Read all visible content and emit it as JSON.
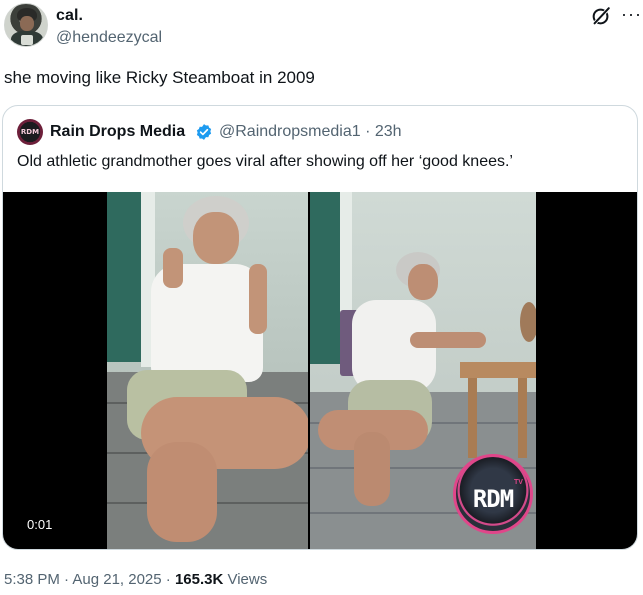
{
  "author": {
    "display_name": "cal.",
    "handle": "@hendeezycal"
  },
  "tweet": {
    "text": "she moving like Ricky Steamboat in 2009"
  },
  "quoted": {
    "display_name": "Rain Drops Media",
    "handle_time": "@Raindropsmedia1 · 23h",
    "text": "Old athletic grandmother goes viral after showing off her ‘good knees.’",
    "video_time": "0:01",
    "watermark": "RDM",
    "watermark_sub": "TV",
    "avatar_text": "RDM"
  },
  "meta": {
    "datetime": "5:38 PM · Aug 21, 2025 · ",
    "views_count": "165.3K",
    "views_label": " Views"
  },
  "icons": {
    "more": "more-icon",
    "grok": "grok-icon",
    "verified": "verified-icon"
  },
  "colors": {
    "text": "#0f1419",
    "secondary": "#536471",
    "verified": "#1d9bf0",
    "border": "#cfd9de"
  }
}
